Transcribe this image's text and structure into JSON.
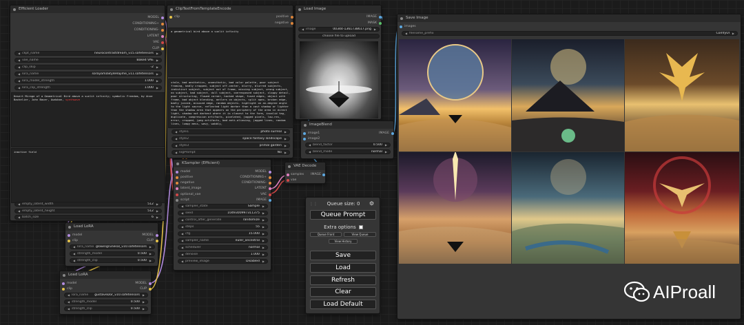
{
  "efficient_loader": {
    "title": "Efficient Loader",
    "outputs": [
      "MODEL",
      "CONDITIONING+",
      "CONDITIONING-",
      "LATENT",
      "VAE",
      "CLIP"
    ],
    "widgets": [
      {
        "label": "ckpt_name",
        "value": "neurocontrastdream_v15.safetensors"
      },
      {
        "label": "vae_name",
        "value": "Baked VAE"
      },
      {
        "label": "clip_skip",
        "value": "-2"
      },
      {
        "label": "lora_name",
        "value": "sorayamaStyleHajime_v11.safetensors"
      },
      {
        "label": "lora_model_strength",
        "value": "1.000"
      },
      {
        "label": "lora_clip_strength",
        "value": "1.000"
      }
    ],
    "positive_text": "Desert Mirage of a Geometrical Bird above a sunlit infinity; symbolic Freedom, by Anne Bachelier, John Bauer, Awdubon, ",
    "positive_text_highlight": "synthwave",
    "negative_text": "inactive field",
    "bottom_widgets": [
      {
        "label": "empty_latent_width",
        "value": "512"
      },
      {
        "label": "empty_latent_height",
        "value": "512"
      },
      {
        "label": "batch_size",
        "value": "6"
      }
    ]
  },
  "clip_text": {
    "title": "ClipTextFromTemplateEncode",
    "input": "clip",
    "outputs": [
      "positive",
      "negative"
    ],
    "prompt": "a geometrical bird above a sunlit infinity",
    "negative": "stale, bad aesthetics, unaesthetic, bad color palette, poor subject framing, badly cropped, subject off-center, blurry, blurred subjects, indistinct subject, subject out of frame, missing subject, wrong subject, no subject, bad subject, dull subject, overexposed subject, sloppy detail, poor structuring, flawed corner, hacked shape, fused edges, object with frame, bad object blending, antlers on objects, split apex, broken edge, badly joined, misused edge, random objects. highlight on an-degree angle to the light source, reflected light darker than a cast shadow or lighter than the shadow area that appears on the periphery of the area in direct light, shadow not darkest where it is closest to the form, invalid tag, duplicate, compression artifacts, pixelated, jagged pixels, low-res, error, cropped, jpeg artifacts, bad anti-aliasing, jagged lines, random lines, lumpy mess, wavy, wobbly,",
    "widgets": [
      {
        "label": "style1",
        "value": "photo surreal"
      },
      {
        "label": "style2",
        "value": "space fantasy landscape"
      },
      {
        "label": "style3",
        "value": "primal garden"
      },
      {
        "label": "logPrompt",
        "value": "No"
      }
    ]
  },
  "load_image": {
    "title": "Load Image",
    "outputs": [
      "IMAGE",
      "MASK"
    ],
    "image_label": "image",
    "image_value": "00344-1361738617.png",
    "upload_label": "choose file to upload"
  },
  "image_blend": {
    "title": "ImageBlend",
    "inputs": [
      "image1",
      "image2"
    ],
    "output": "IMAGE",
    "widgets": [
      {
        "label": "blend_factor",
        "value": "0.500"
      },
      {
        "label": "blend_mode",
        "value": "normal"
      }
    ]
  },
  "save_image": {
    "title": "Save Image",
    "input": "images",
    "widgets": [
      {
        "label": "filename_prefix",
        "value": "ComfyUI"
      }
    ]
  },
  "ksampler": {
    "title": "KSampler (Efficient)",
    "inputs": [
      "model",
      "positive",
      "negative",
      "latent_image",
      "optional_vae",
      "script"
    ],
    "outputs": [
      "MODEL",
      "CONDITIONING+",
      "CONDITIONING-",
      "LATENT",
      "VAE",
      "IMAGE"
    ],
    "widgets": [
      {
        "label": "sampler_state",
        "value": "Sample"
      },
      {
        "label": "seed",
        "value": "1049300997311375"
      },
      {
        "label": "control_after_generate",
        "value": "randomize"
      },
      {
        "label": "steps",
        "value": "55"
      },
      {
        "label": "cfg",
        "value": "15.000"
      },
      {
        "label": "sampler_name",
        "value": "euler_ancestral"
      },
      {
        "label": "scheduler",
        "value": "normal"
      },
      {
        "label": "denoise",
        "value": "1.000"
      },
      {
        "label": "preview_image",
        "value": "Disabled"
      }
    ]
  },
  "vae_decode": {
    "title": "VAE Decode",
    "inputs": [
      "samples",
      "vae"
    ],
    "output": "IMAGE"
  },
  "lora1": {
    "title": "Load LoRA",
    "inputs": [
      "model",
      "clip"
    ],
    "outputs": [
      "MODEL",
      "CLIP"
    ],
    "widgets": [
      {
        "label": "lora_name",
        "value": "glowingrunesal_v10.safetensors"
      },
      {
        "label": "strength_model",
        "value": "0.500"
      },
      {
        "label": "strength_clip",
        "value": "0.500"
      }
    ]
  },
  "lora2": {
    "title": "Load LoRA",
    "inputs": [
      "model",
      "clip"
    ],
    "outputs": [
      "MODEL",
      "CLIP"
    ],
    "widgets": [
      {
        "label": "lora_name",
        "value": "gustaveDor_v10.safetensors"
      },
      {
        "label": "strength_model",
        "value": "0.500"
      },
      {
        "label": "strength_clip",
        "value": "0.500"
      }
    ]
  },
  "queue_panel": {
    "queue_size": "Queue size: 0",
    "queue_prompt": "Queue Prompt",
    "extra_options": "Extra options",
    "queue_front": "Queue Front",
    "view_queue": "View Queue",
    "view_history": "View History",
    "save": "Save",
    "load": "Load",
    "refresh": "Refresh",
    "clear": "Clear",
    "load_default": "Load Default"
  },
  "watermark": {
    "text": "AIProall"
  },
  "colors": {
    "wire_yellow": "#e6c34a",
    "wire_purple": "#b38ce0",
    "wire_orange": "#e58a3c",
    "wire_red": "#d24848",
    "wire_pink": "#e080c0",
    "wire_blue": "#5da8e0"
  }
}
